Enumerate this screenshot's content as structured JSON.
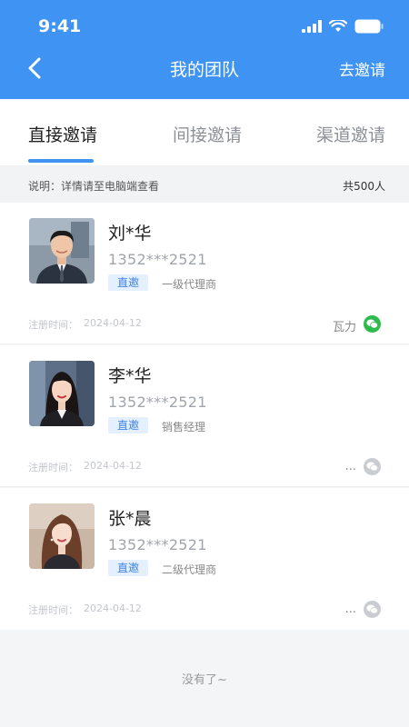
{
  "status_bar": {
    "time": "9:41"
  },
  "nav": {
    "title": "我的团队",
    "action": "去邀请"
  },
  "tabs": [
    {
      "label": "直接邀请",
      "active": true
    },
    {
      "label": "间接邀请",
      "active": false
    },
    {
      "label": "渠道邀请",
      "active": false
    }
  ],
  "notice": {
    "text": "说明：详情请至电脑端查看",
    "count": "共500人"
  },
  "members": [
    {
      "name": "刘*华",
      "phone": "1352***2521",
      "tag": "直邀",
      "role": "一级代理商",
      "reg_label": "注册时间：",
      "reg_date": "2024-04-12",
      "source": "瓦力",
      "wechat_bound": true
    },
    {
      "name": "李*华",
      "phone": "1352***2521",
      "tag": "直邀",
      "role": "销售经理",
      "reg_label": "注册时间：",
      "reg_date": "2024-04-12",
      "source": "...",
      "wechat_bound": false
    },
    {
      "name": "张*晨",
      "phone": "1352***2521",
      "tag": "直邀",
      "role": "二级代理商",
      "reg_label": "注册时间：",
      "reg_date": "2024-04-12",
      "source": "...",
      "wechat_bound": false
    }
  ],
  "footer": {
    "text": "没有了~"
  },
  "colors": {
    "primary": "#3f93f2",
    "wechat_green": "#2dbb4c",
    "tag_bg": "#e4efff"
  },
  "icons": {
    "back": "chevron-left-icon",
    "signal": "signal-icon",
    "wifi": "wifi-icon",
    "battery": "battery-icon",
    "wechat": "wechat-icon"
  }
}
